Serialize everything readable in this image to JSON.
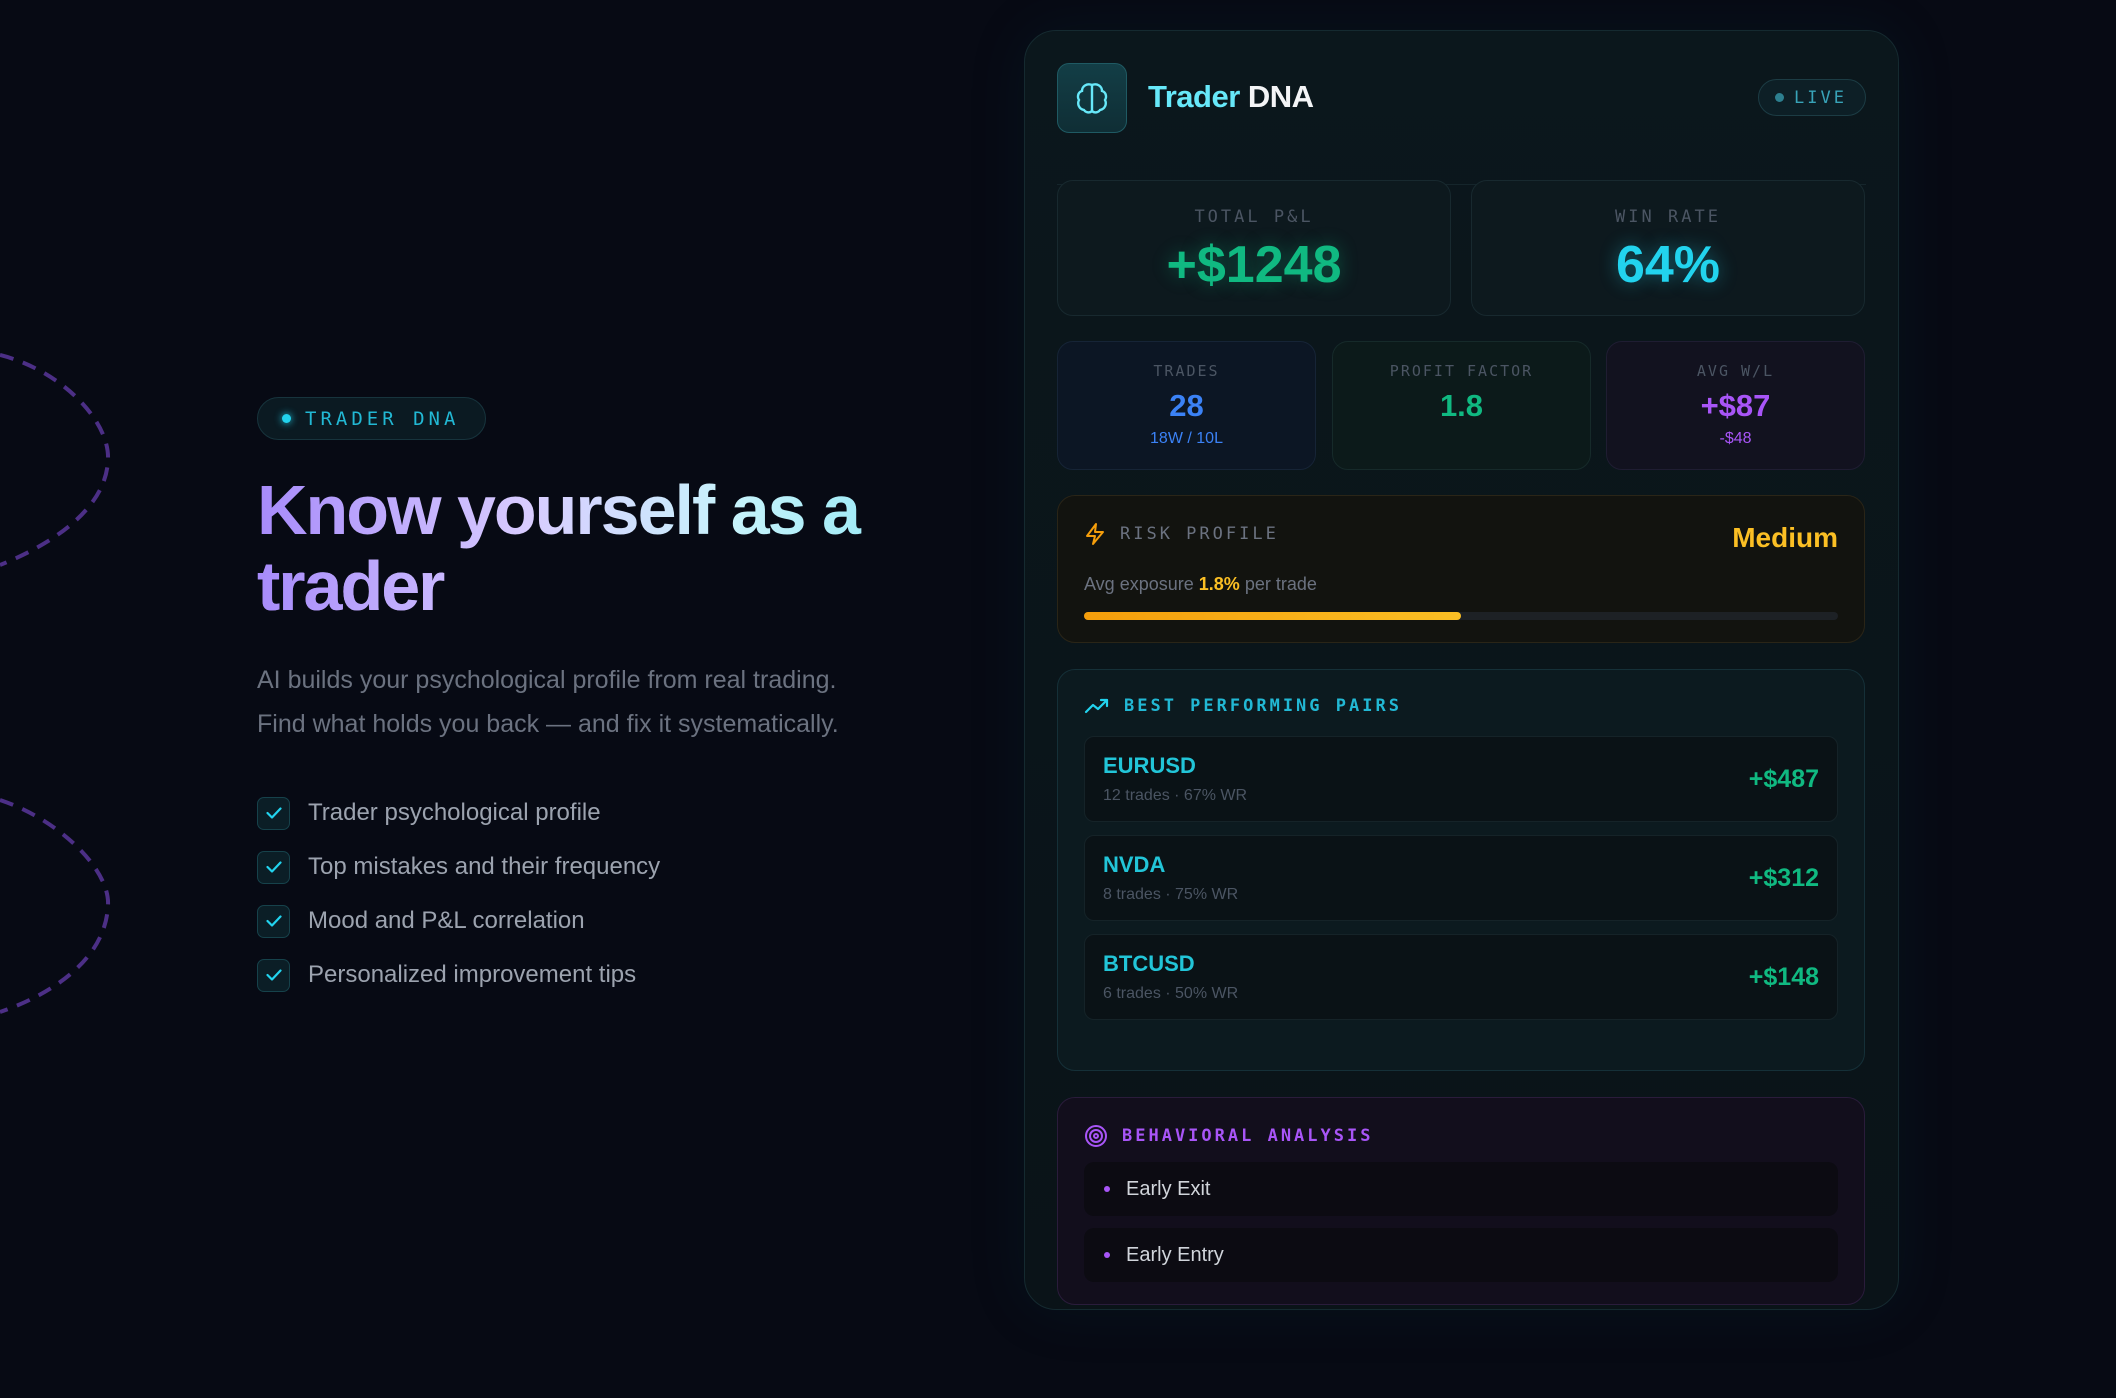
{
  "hero": {
    "badge": "TRADER DNA",
    "title_line1": "Know yourself as a",
    "title_line2": "trader",
    "subtitle_line1": "AI builds your psychological profile from real trading.",
    "subtitle_line2": "Find what holds you back — and fix it systematically.",
    "features": [
      "Trader psychological profile",
      "Top mistakes and their frequency",
      "Mood and P&L correlation",
      "Personalized improvement tips"
    ]
  },
  "card": {
    "brand_part1": "Trader",
    "brand_part2": "DNA",
    "live_label": "LIVE",
    "total_pnl": {
      "label": "TOTAL P&L",
      "value": "+$1248",
      "color": "#10b981"
    },
    "win_rate": {
      "label": "WIN RATE",
      "value": "64%",
      "color": "#22d3ee"
    },
    "trades": {
      "label": "TRADES",
      "value": "28",
      "sub": "18W / 10L",
      "color": "#3b82f6"
    },
    "profit_factor": {
      "label": "PROFIT FACTOR",
      "value": "1.8",
      "color": "#10b981"
    },
    "avg_wl": {
      "label": "AVG W/L",
      "value": "+$87",
      "sub": "-$48",
      "color": "#a855f7"
    },
    "risk": {
      "label": "RISK PROFILE",
      "level": "Medium",
      "text_prefix": "Avg exposure",
      "exposure": "1.8%",
      "text_suffix": "per trade",
      "fill_fraction": 0.5
    },
    "pairs": {
      "label": "BEST PERFORMING PAIRS",
      "items": [
        {
          "name": "EURUSD",
          "meta": "12 trades · 67% WR",
          "pnl": "+$487"
        },
        {
          "name": "NVDA",
          "meta": "8 trades · 75% WR",
          "pnl": "+$312"
        },
        {
          "name": "BTCUSD",
          "meta": "6 trades · 50% WR",
          "pnl": "+$148"
        }
      ]
    },
    "behavior": {
      "label": "BEHAVIORAL ANALYSIS",
      "items": [
        "Early Exit",
        "Early Entry"
      ]
    }
  }
}
